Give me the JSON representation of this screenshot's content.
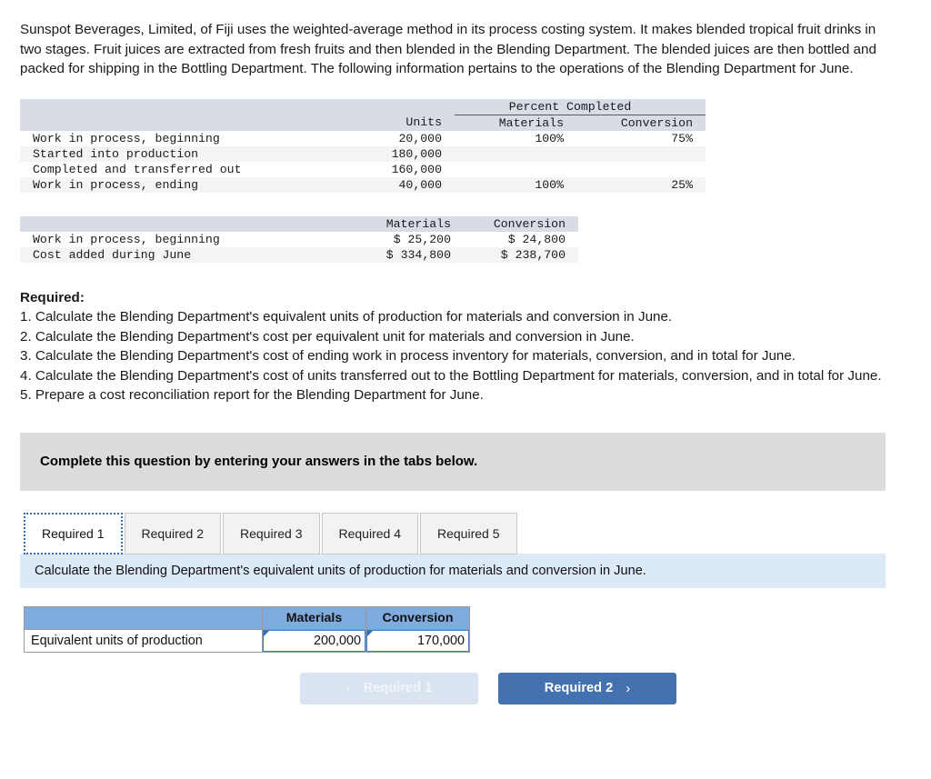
{
  "intro": "Sunspot Beverages, Limited, of Fiji uses the weighted-average method in its process costing system. It makes blended tropical fruit drinks in two stages. Fruit juices are extracted from fresh fruits and then blended in the Blending Department. The blended juices are then bottled and packed for shipping in the Bottling Department. The following information pertains to the operations of the Blending Department for June.",
  "units_table": {
    "group_header": "Percent Completed",
    "columns": [
      "",
      "Units",
      "Materials",
      "Conversion"
    ],
    "rows": [
      {
        "label": "Work in process, beginning",
        "units": "20,000",
        "materials": "100%",
        "conversion": "75%"
      },
      {
        "label": "Started into production",
        "units": "180,000",
        "materials": "",
        "conversion": ""
      },
      {
        "label": "Completed and transferred out",
        "units": "160,000",
        "materials": "",
        "conversion": ""
      },
      {
        "label": "Work in process, ending",
        "units": "40,000",
        "materials": "100%",
        "conversion": "25%"
      }
    ]
  },
  "cost_table": {
    "columns": [
      "",
      "Materials",
      "Conversion"
    ],
    "rows": [
      {
        "label": "Work in process, beginning",
        "materials": "$ 25,200",
        "conversion": "$ 24,800"
      },
      {
        "label": "Cost added during June",
        "materials": "$ 334,800",
        "conversion": "$ 238,700"
      }
    ]
  },
  "required": {
    "title": "Required:",
    "items": [
      "1. Calculate the Blending Department's equivalent units of production for materials and conversion in June.",
      "2. Calculate the Blending Department's cost per equivalent unit for materials and conversion in June.",
      "3. Calculate the Blending Department's cost of ending work in process inventory for materials, conversion, and in total for June.",
      "4. Calculate the Blending Department's cost of units transferred out to the Bottling Department for materials, conversion, and in total for June.",
      "5. Prepare a cost reconciliation report for the Blending Department for June."
    ]
  },
  "banner": "Complete this question by entering your answers in the tabs below.",
  "tabs": [
    {
      "label": "Required 1",
      "active": true
    },
    {
      "label": "Required 2",
      "active": false
    },
    {
      "label": "Required 3",
      "active": false
    },
    {
      "label": "Required 4",
      "active": false
    },
    {
      "label": "Required 5",
      "active": false
    }
  ],
  "tab_instruction": "Calculate the Blending Department's equivalent units of production for materials and conversion in June.",
  "answer_table": {
    "headers": [
      "",
      "Materials",
      "Conversion"
    ],
    "row_label": "Equivalent units of production",
    "materials_value": "200,000",
    "conversion_value": "170,000"
  },
  "nav": {
    "prev_label": "Required 1",
    "next_label": "Required 2",
    "prev_chevron": "‹",
    "next_chevron": "›"
  },
  "colors": {
    "header_blue": "#7fabde",
    "active_button": "#4472b0",
    "disabled_button": "#d9e4f0",
    "info_bar": "#dce9f7",
    "banner_gray": "#dcdcdc",
    "table_header_band": "#d8dce4",
    "input_border": "#3f7fc1"
  }
}
